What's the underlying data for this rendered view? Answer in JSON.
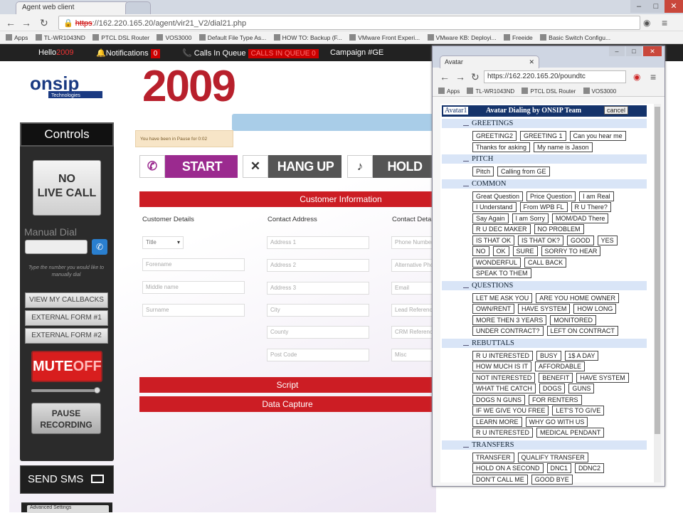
{
  "browser": {
    "tabs": [
      {
        "title": "Agent web client"
      },
      {
        "title": ""
      }
    ],
    "url_scheme": "https",
    "url_rest": "://162.220.165.20/agent/vir21_V2/dial21.php",
    "bookmarks": [
      "Apps",
      "TL-WR1043ND",
      "PTCL DSL Router",
      "VOS3000",
      "Default File Type As...",
      "HOW TO: Backup (F...",
      "VMware Front Experi...",
      "VMware KB: Deployi...",
      "Freeide",
      "Basic Switch Configu..."
    ]
  },
  "appbar": {
    "hello": "Hello",
    "user": "2009",
    "notifications_label": "Notifications",
    "notifications_count": "0",
    "calls_label": "Calls In Queue",
    "calls_badge": "CALLS IN QUEUE 0",
    "campaign_label": "Campaign",
    "campaign_value": "#GE"
  },
  "page": {
    "agent_number": "2009",
    "pause_note": "You have been in Pause for 0:02"
  },
  "controls": {
    "title": "Controls",
    "no_live_call": [
      "NO",
      "LIVE CALL"
    ],
    "manual_dial_label": "Manual Dial",
    "hint": "Type the number you would like to manually dial",
    "view_callbacks": "VIEW MY CALLBACKS",
    "external_form_1": "EXTERNAL FORM #1",
    "external_form_2": "EXTERNAL FORM #2",
    "mute": "MUTE",
    "mute_state": "OFF",
    "pause_recording": [
      "PAUSE",
      "RECORDING"
    ],
    "send_sms": "SEND SMS",
    "bottom_select": "Advanced Settings"
  },
  "actions": {
    "start": "START CALLS",
    "hangup": "HANG UP",
    "hold": "HOLD"
  },
  "customer_info": {
    "title": "Customer Information",
    "col1_header": "Customer Details",
    "col2_header": "Contact Address",
    "col3_header": "Contact Details",
    "title_select": "Title",
    "col1": [
      "Forename",
      "Middle name",
      "Surname"
    ],
    "col2": [
      "Address 1",
      "Address 2",
      "Address 3",
      "City",
      "County",
      "Post Code"
    ],
    "col3": [
      "Phone Number",
      "Alternative Phone",
      "Email",
      "Lead Reference",
      "CRM Reference",
      "Misc"
    ]
  },
  "script_bar": "Script",
  "data_capture_bar": "Data Capture",
  "popup": {
    "tab_title": "Avatar",
    "url": "https://162.220.165.20/poundtc",
    "bookmarks": [
      "Apps",
      "TL-WR1043ND",
      "PTCL DSL Router",
      "VOS3000"
    ],
    "header_label": "Avatar1",
    "header_title": "Avatar Dialing by ONSIP Team",
    "cancel": "cancel",
    "sections": [
      {
        "title": "GREETINGS",
        "rows": [
          [
            "GREETING2",
            "GREETING 1",
            "Can you hear me"
          ],
          [
            "Thanks for asking",
            "My name is Jason"
          ]
        ]
      },
      {
        "title": "PITCH",
        "rows": [
          [
            "Pitch",
            "Calling from GE"
          ]
        ]
      },
      {
        "title": "COMMON",
        "rows": [
          [
            "Great Question",
            "Price Question",
            "I am Real"
          ],
          [
            "I Understand",
            "From WPB FL",
            "R U There?"
          ],
          [
            "Say Again",
            "I am Sorry",
            "MOM/DAD There"
          ],
          [
            "R U DEC MAKER",
            "NO PROBLEM"
          ],
          [
            "IS THAT OK",
            "IS THAT OK?",
            "GOOD",
            "YES"
          ],
          [
            "NO",
            "OK",
            "SURE",
            "SORRY TO HEAR"
          ],
          [
            "WONDERFUL",
            "CALL BACK"
          ],
          [
            "SPEAK TO THEM"
          ]
        ]
      },
      {
        "title": "QUESTIONS",
        "rows": [
          [
            "LET ME ASK YOU",
            "ARE YOU HOME OWNER"
          ],
          [
            "OWN/RENT",
            "HAVE SYSTEM",
            "HOW LONG"
          ],
          [
            "MORE THEN 3 YEARS",
            "MONITORED"
          ],
          [
            "UNDER CONTRACT?",
            "LEFT ON CONTRACT"
          ]
        ]
      },
      {
        "title": "REBUTTALS",
        "rows": [
          [
            "R U INTERESTED",
            "BUSY",
            "1$ A DAY"
          ],
          [
            "HOW MUCH IS IT",
            "AFFORDABLE"
          ],
          [
            "NOT INTERESTED",
            "BENEFIT",
            "HAVE SYSTEM"
          ],
          [
            "WHAT THE CATCH",
            "DOGS",
            "GUNS"
          ],
          [
            "DOGS N GUNS",
            "FOR RENTERS"
          ],
          [
            "IF WE GIVE YOU FREE",
            "LET'S TO GIVE"
          ],
          [
            "LEARN MORE",
            "WHY GO WITH US"
          ],
          [
            "R U INTERESTED",
            "MEDICAL PENDANT"
          ]
        ]
      },
      {
        "title": "TRANSFERS",
        "rows": [
          [
            "TRANSFER",
            "QUALIFY TRANSFER"
          ],
          [
            "HOLD ON A SECOND",
            "DNC1",
            "DDNC2"
          ],
          [
            "DON'T CALL ME",
            "GOOD BYE"
          ]
        ]
      }
    ]
  }
}
